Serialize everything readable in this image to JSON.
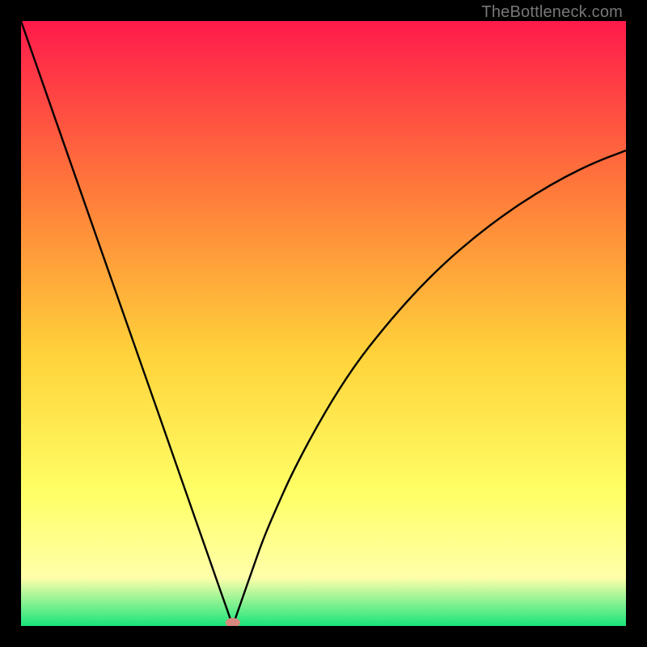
{
  "watermark": "TheBottleneck.com",
  "chart_data": {
    "type": "line",
    "title": "",
    "xlabel": "",
    "ylabel": "",
    "x_range": [
      0,
      100
    ],
    "y_range": [
      0,
      100
    ],
    "background_gradient": {
      "top": "#ff1a4b",
      "upper_mid": "#ff7a3a",
      "mid": "#ffd23a",
      "lower_mid": "#ffff66",
      "near_bottom": "#ffffaa",
      "bottom": "#18e57a"
    },
    "series": [
      {
        "name": "bottleneck-curve",
        "color": "#000000",
        "stroke_width": 2.4,
        "x": [
          0,
          5,
          10,
          15,
          20,
          25,
          28,
          30,
          32,
          33,
          34,
          35,
          36,
          38,
          40,
          42,
          45,
          50,
          55,
          60,
          65,
          70,
          75,
          80,
          85,
          90,
          95,
          100
        ],
        "y": [
          100,
          85.7,
          71.4,
          57.1,
          42.9,
          28.6,
          20.0,
          14.3,
          8.6,
          5.7,
          2.9,
          0.0,
          2.9,
          8.6,
          14.3,
          19.0,
          25.7,
          35.0,
          42.9,
          49.3,
          55.0,
          60.0,
          64.3,
          68.1,
          71.4,
          74.3,
          76.7,
          78.6
        ]
      }
    ],
    "marker": {
      "x": 35,
      "y": 0,
      "color": "#d9887f",
      "rx": 9,
      "ry": 6
    }
  }
}
